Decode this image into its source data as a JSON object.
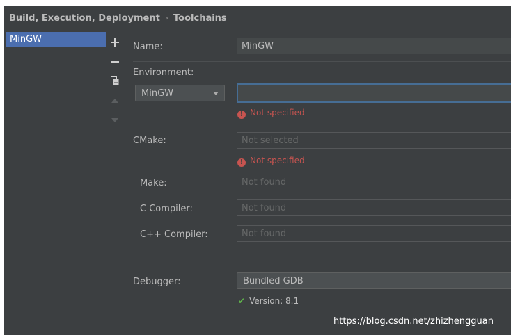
{
  "breadcrumb": {
    "parent": "Build, Execution, Deployment",
    "separator": "›",
    "current": "Toolchains"
  },
  "toolchains": {
    "items": [
      {
        "label": "MinGW",
        "selected": true
      }
    ]
  },
  "toolbar": {
    "buttons": [
      "add-icon",
      "remove-icon",
      "copy-icon",
      "move-up-icon",
      "move-down-icon"
    ]
  },
  "form": {
    "name": {
      "label": "Name:",
      "value": "MinGW"
    },
    "environment": {
      "label": "Environment:",
      "combo_value": "MinGW",
      "path_value": "",
      "error": "Not specified"
    },
    "cmake": {
      "label": "CMake:",
      "placeholder": "Not selected",
      "error": "Not specified"
    },
    "make": {
      "label": "Make:",
      "placeholder": "Not found"
    },
    "c_compiler": {
      "label": "C Compiler:",
      "placeholder": "Not found"
    },
    "cpp_compiler": {
      "label": "C++ Compiler:",
      "placeholder": "Not found"
    },
    "debugger": {
      "label": "Debugger:",
      "value": "Bundled GDB",
      "version": "Version: 8.1"
    }
  },
  "watermark": "https://blog.csdn.net/zhizhengguan",
  "colors": {
    "background": "#3c3f41",
    "selection": "#4b6eaf",
    "error": "#c75450",
    "success": "#5fb34b",
    "focus_border": "#466d94"
  }
}
